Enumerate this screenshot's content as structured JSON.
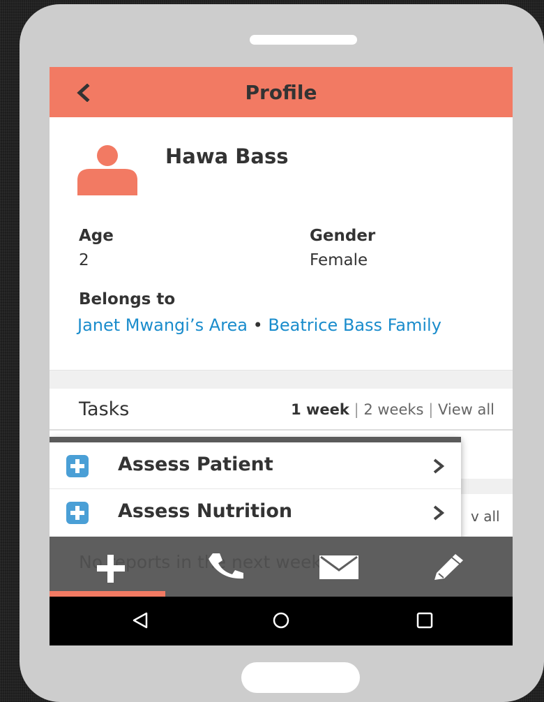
{
  "header": {
    "title": "Profile",
    "back_icon": "chevron-left-icon"
  },
  "person": {
    "name": "Hawa Bass",
    "avatar_icon": "person-icon",
    "age_label": "Age",
    "age_value": "2",
    "gender_label": "Gender",
    "gender_value": "Female",
    "belongs_label": "Belongs to",
    "area_link": "Janet Mwangi’s Area",
    "separator": "•",
    "family_link": "Beatrice Bass Family"
  },
  "tasks": {
    "title": "Tasks",
    "filter_1": "1 week",
    "filter_2": "2 weeks",
    "filter_3": "View all",
    "divider": "|"
  },
  "reports": {
    "view_all_partial": "v all",
    "empty_message_partial": "No reports in the next week."
  },
  "action_menu": {
    "items": [
      {
        "label": "Assess Patient",
        "icon": "plus-box-icon"
      },
      {
        "label": "Assess Nutrition",
        "icon": "plus-box-icon"
      }
    ]
  },
  "tab_bar": {
    "tabs": [
      "plus-icon",
      "phone-icon",
      "envelope-icon",
      "pencil-icon"
    ],
    "active_index": 0
  },
  "android_nav": [
    "back-triangle-icon",
    "home-circle-icon",
    "recents-square-icon"
  ],
  "colors": {
    "accent": "#f27a63",
    "link": "#1a8ccc",
    "tab_bar": "#5e5e5e",
    "icon_blue": "#4a9fd6"
  }
}
